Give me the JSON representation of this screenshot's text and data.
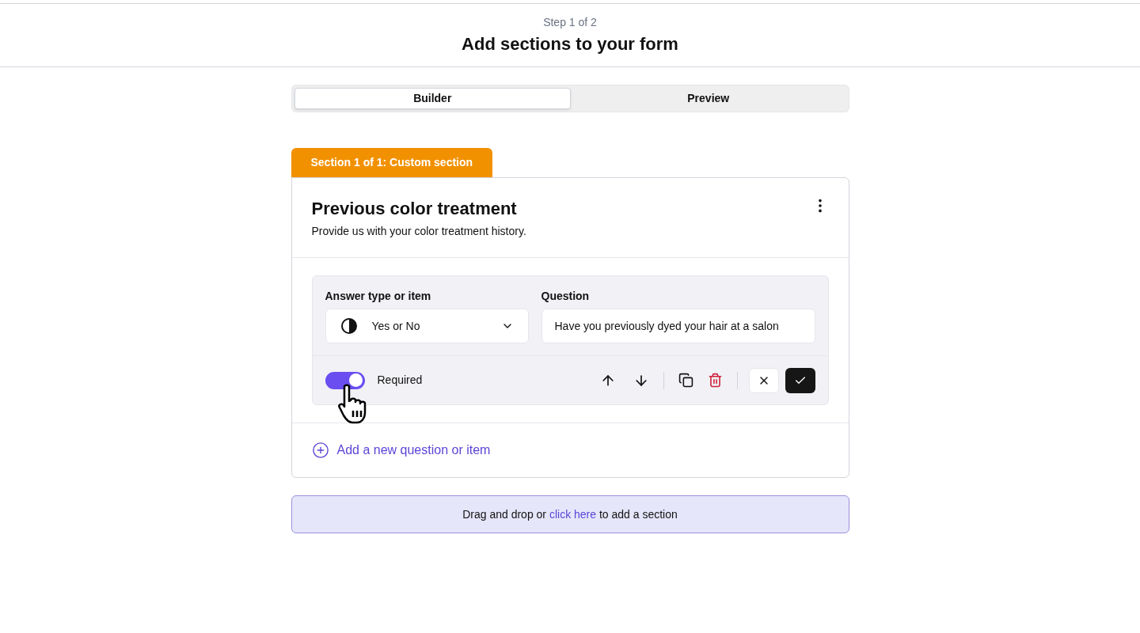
{
  "header": {
    "step": "Step 1 of 2",
    "title": "Add sections to your form"
  },
  "tabs": [
    {
      "label": "Builder",
      "selected": true
    },
    {
      "label": "Preview",
      "selected": false
    }
  ],
  "section": {
    "tag": "Section 1 of 1: Custom section",
    "title": "Previous color treatment",
    "description": "Provide us with your color treatment history.",
    "question": {
      "answer_type_label": "Answer type or item",
      "answer_type": "Yes or No",
      "question_label": "Question",
      "question_value": "Have you previously dyed your hair at a salon",
      "required_label": "Required",
      "required": true
    },
    "add_item": "Add a new question or item"
  },
  "dropzone": {
    "before": "Drag and drop or",
    "link": "click here",
    "after": "to add a section"
  }
}
